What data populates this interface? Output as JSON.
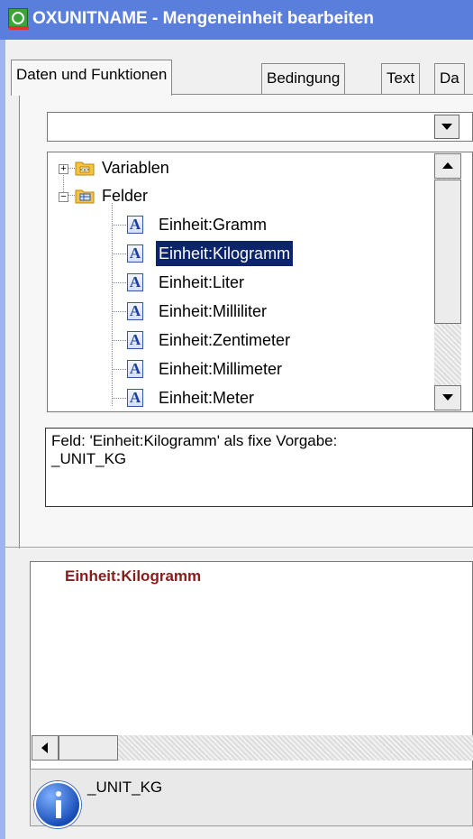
{
  "window": {
    "title": "OXUNITNAME - Mengeneinheit bearbeiten"
  },
  "tabs": [
    {
      "label": "Daten und Funktionen",
      "active": true
    },
    {
      "label": "Bedingung",
      "active": false
    },
    {
      "label": "Text",
      "active": false
    },
    {
      "label": "Da",
      "active": false
    }
  ],
  "combo": {
    "value": ""
  },
  "tree": {
    "groups": [
      {
        "label": "Variablen",
        "expanded": false,
        "icon": "variables-folder-icon"
      },
      {
        "label": "Felder",
        "expanded": true,
        "icon": "fields-folder-icon"
      }
    ],
    "fields": [
      {
        "label": "Einheit:Gramm",
        "selected": false
      },
      {
        "label": "Einheit:Kilogramm",
        "selected": true
      },
      {
        "label": "Einheit:Liter",
        "selected": false
      },
      {
        "label": "Einheit:Milliliter",
        "selected": false
      },
      {
        "label": "Einheit:Zentimeter",
        "selected": false
      },
      {
        "label": "Einheit:Millimeter",
        "selected": false
      },
      {
        "label": "Einheit:Meter",
        "selected": false
      }
    ]
  },
  "description": {
    "line1": "Feld: 'Einheit:Kilogramm' als fixe Vorgabe:",
    "line2": "_UNIT_KG"
  },
  "formula": {
    "text": "Einheit:Kilogramm"
  },
  "status": {
    "icon": "info-icon",
    "text": "_UNIT_KG"
  },
  "colors": {
    "titlebar": "#5a7edc",
    "selection": "#0b246b",
    "formula_text": "#8b1a1a"
  }
}
